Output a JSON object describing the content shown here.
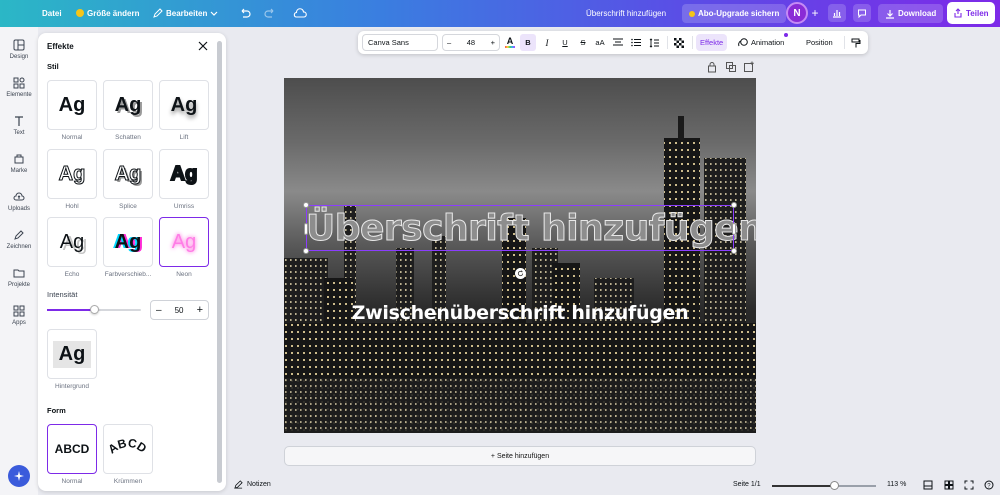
{
  "topbar": {
    "file_label": "Datei",
    "resize_label": "Größe ändern",
    "edit_label": "Bearbeiten",
    "doc_title": "Überschrift hinzufügen",
    "upgrade_label": "Abo-Upgrade sichern",
    "avatar_initial": "N",
    "download_label": "Download",
    "share_label": "Teilen"
  },
  "rail": {
    "items": [
      {
        "label": "Design",
        "icon": "layout-icon"
      },
      {
        "label": "Elemente",
        "icon": "shapes-icon"
      },
      {
        "label": "Text",
        "icon": "text-icon"
      },
      {
        "label": "Marke",
        "icon": "brand-icon"
      },
      {
        "label": "Uploads",
        "icon": "cloud-upload-icon"
      },
      {
        "label": "Zeichnen",
        "icon": "pen-icon"
      },
      {
        "label": "Projekte",
        "icon": "folder-icon"
      },
      {
        "label": "Apps",
        "icon": "apps-icon"
      }
    ]
  },
  "panel": {
    "title": "Effekte",
    "style_label": "Stil",
    "tile_text": "Ag",
    "styles": [
      {
        "label": "Normal"
      },
      {
        "label": "Schatten"
      },
      {
        "label": "Lift"
      },
      {
        "label": "Hohl"
      },
      {
        "label": "Splice"
      },
      {
        "label": "Umriss"
      },
      {
        "label": "Echo"
      },
      {
        "label": "Farbverschieb..."
      },
      {
        "label": "Neon"
      }
    ],
    "intensity_label": "Intensität",
    "intensity_value": "50",
    "intensity_fraction": 0.5,
    "background_label": "Hintergrund",
    "shape_label": "Form",
    "shape_text": "ABCD",
    "shapes": [
      {
        "label": "Normal"
      },
      {
        "label": "Krümmen"
      }
    ]
  },
  "toolbar": {
    "font_name": "Canva Sans",
    "font_size": "48",
    "minus": "–",
    "plus": "+",
    "case_label": "aA",
    "effects_label": "Effekte",
    "animation_label": "Animation",
    "position_label": "Position"
  },
  "canvas": {
    "heading": "Überschrift hinzufügen",
    "subheading": "Zwischenüberschrift hinzufügen",
    "add_page_label": "+ Seite hinzufügen"
  },
  "bottombar": {
    "notes_label": "Notizen",
    "page_label": "Seite 1/1",
    "zoom_label": "113 %",
    "zoom_fraction": 0.6
  },
  "colors": {
    "accent": "#7d2ae8",
    "neon": "#ff4fd8"
  }
}
